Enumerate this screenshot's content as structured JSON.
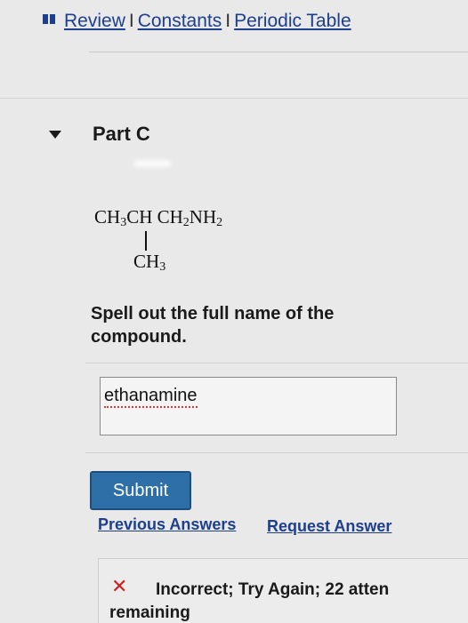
{
  "header": {
    "links": [
      "Review",
      "Constants",
      "Periodic Table"
    ],
    "separator": "I"
  },
  "part": {
    "title": "Part C"
  },
  "formula": {
    "main": [
      "CH",
      "3",
      "CH CH",
      "2",
      "NH",
      "2"
    ],
    "branch": [
      "CH",
      "3"
    ]
  },
  "question": {
    "text": "Spell out the full name of the compound."
  },
  "answer": {
    "value": "ethanamine"
  },
  "actions": {
    "submit_label": "Submit",
    "previous_answers": "Previous Answers",
    "request_answer": "Request Answer"
  },
  "feedback": {
    "icon": "cross-icon",
    "text": "Incorrect; Try Again; 22 atten remaining"
  },
  "colors": {
    "link": "#1d3f8c",
    "button": "#2f6fa8",
    "error": "#d11d1d"
  }
}
